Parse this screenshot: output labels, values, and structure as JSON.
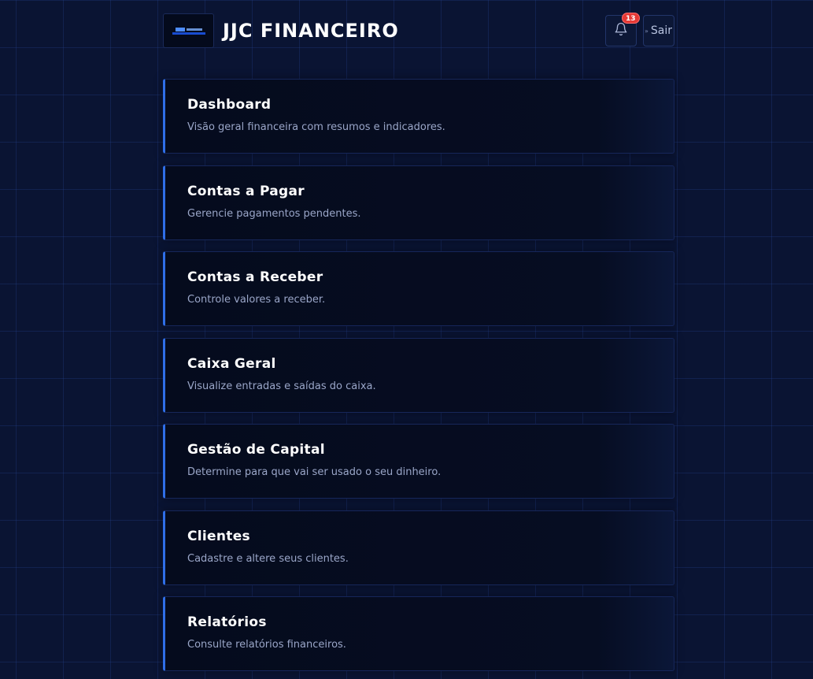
{
  "header": {
    "app_title": "JJC FINANCEIRO",
    "logo_icon": "jjc-logo",
    "notification_icon": "bell-icon",
    "notification_count": "13",
    "logout_label": "Sair",
    "logout_icon": "chevron-right-double-icon"
  },
  "menu": {
    "items": [
      {
        "title": "Dashboard",
        "description": "Visão geral financeira com resumos e indicadores."
      },
      {
        "title": "Contas a Pagar",
        "description": "Gerencie pagamentos pendentes."
      },
      {
        "title": "Contas a Receber",
        "description": "Controle valores a receber."
      },
      {
        "title": "Caixa Geral",
        "description": "Visualize entradas e saídas do caixa."
      },
      {
        "title": "Gestão de Capital",
        "description": "Determine para que vai ser usado o seu dinheiro."
      },
      {
        "title": "Clientes",
        "description": "Cadastre e altere seus clientes."
      },
      {
        "title": "Relatórios",
        "description": "Consulte relatórios financeiros."
      }
    ]
  },
  "colors": {
    "background": "#0a1433",
    "accent": "#2f6ee8",
    "badge": "#e53935"
  }
}
